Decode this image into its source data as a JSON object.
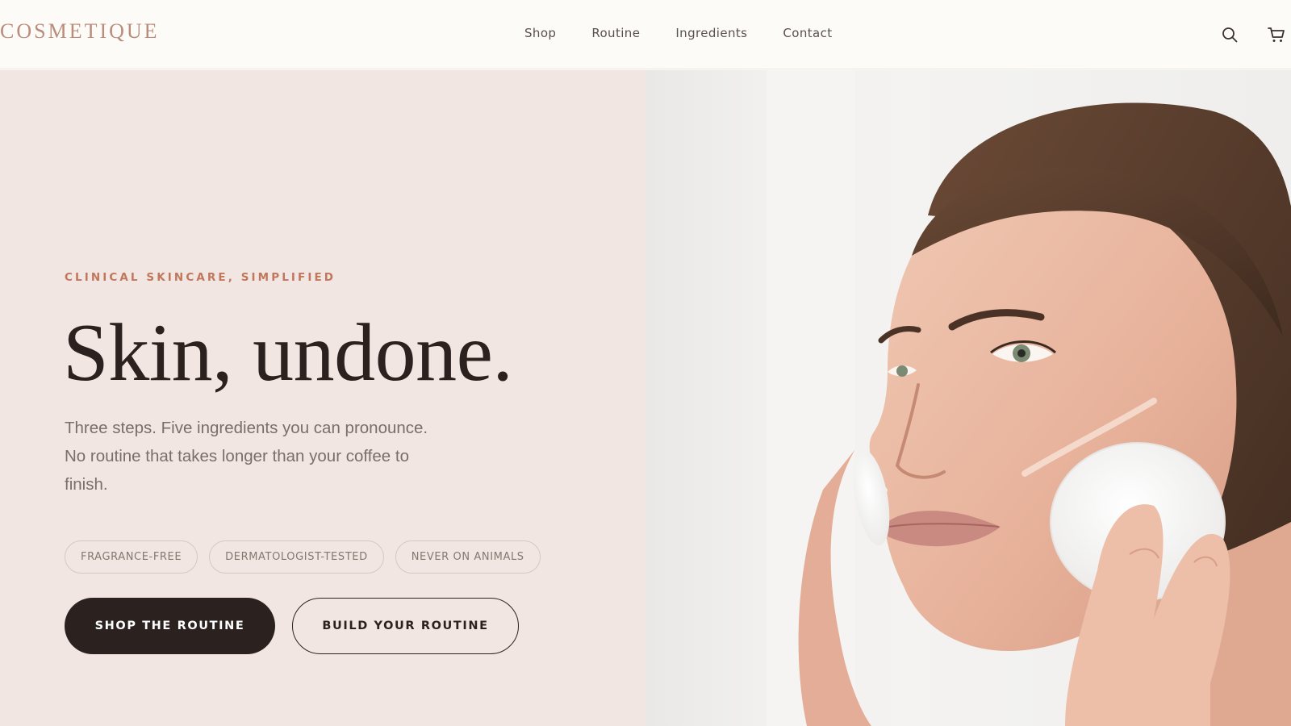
{
  "brand": {
    "logo": "COSMETIQUE"
  },
  "nav": {
    "items": [
      {
        "label": "Shop"
      },
      {
        "label": "Routine"
      },
      {
        "label": "Ingredients"
      },
      {
        "label": "Contact"
      }
    ]
  },
  "header_icons": {
    "search": "search-icon",
    "cart": "cart-icon"
  },
  "hero": {
    "eyebrow": "CLINICAL SKINCARE, SIMPLIFIED",
    "headline": "Skin, undone.",
    "body": "Three steps. Five ingredients you can pronounce. No routine that takes longer than your coffee to finish.",
    "badges": [
      {
        "label": "FRAGRANCE-FREE"
      },
      {
        "label": "DERMATOLOGIST-TESTED"
      },
      {
        "label": "NEVER ON ANIMALS"
      }
    ],
    "primary_cta": "SHOP THE ROUTINE",
    "secondary_cta": "BUILD YOUR ROUTINE"
  },
  "colors": {
    "panel_bg": "#f2e6e3",
    "accent": "#c0775b",
    "logo": "#b98c7b",
    "ink": "#2b2220"
  }
}
